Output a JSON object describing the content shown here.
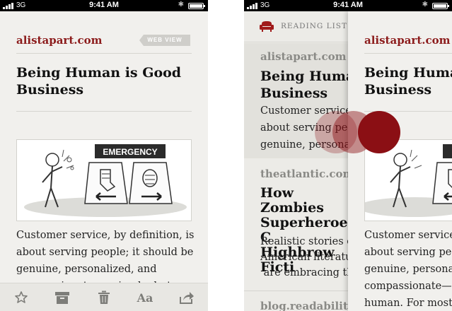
{
  "status_bar": {
    "carrier": "3G",
    "time": "9:41 AM"
  },
  "left_screen": {
    "site": "alistapart.com",
    "badge": "WEB VIEW",
    "title_lines": [
      "Being Human is Good",
      "Business"
    ],
    "illustration_sign": "EMERGENCY",
    "body_lines": [
      "Customer service, by definition, is",
      "about serving people; it should be",
      "genuine, personalized, and",
      "compassionate—a simple, but"
    ],
    "toolbar": {
      "star_icon": "star-icon",
      "archive_icon": "archive-icon",
      "trash_icon": "trash-icon",
      "text_size_label": "Aa",
      "share_icon": "share-icon"
    }
  },
  "right_screen": {
    "header_label": "READING LIST",
    "items": [
      {
        "site": "alistapart.com",
        "title_lines": [
          "Being Human",
          "Business"
        ],
        "excerpt_lines": [
          "Customer service,",
          "about serving peo",
          "genuine, personali"
        ]
      },
      {
        "site": "theatlantic.com",
        "title_lines": [
          "How Zombies",
          "Superheroes C",
          "Highbrow Ficti"
        ],
        "excerpt_lines": [
          "Realistic stories on",
          "American literatur",
          " are embracing the"
        ]
      },
      {
        "site": "blog.readability.co",
        "title_lines": [],
        "excerpt_lines": []
      }
    ],
    "panel": {
      "site": "alistapart.com",
      "title_lines": [
        "Being Human",
        "Business"
      ],
      "body_lines": [
        "Customer service",
        "about serving peo",
        "genuine, personal",
        "compassionate—c",
        "human. For most"
      ]
    }
  },
  "colors": {
    "accent": "#8c1c1c",
    "touch_indicator": "#8b0f14"
  }
}
